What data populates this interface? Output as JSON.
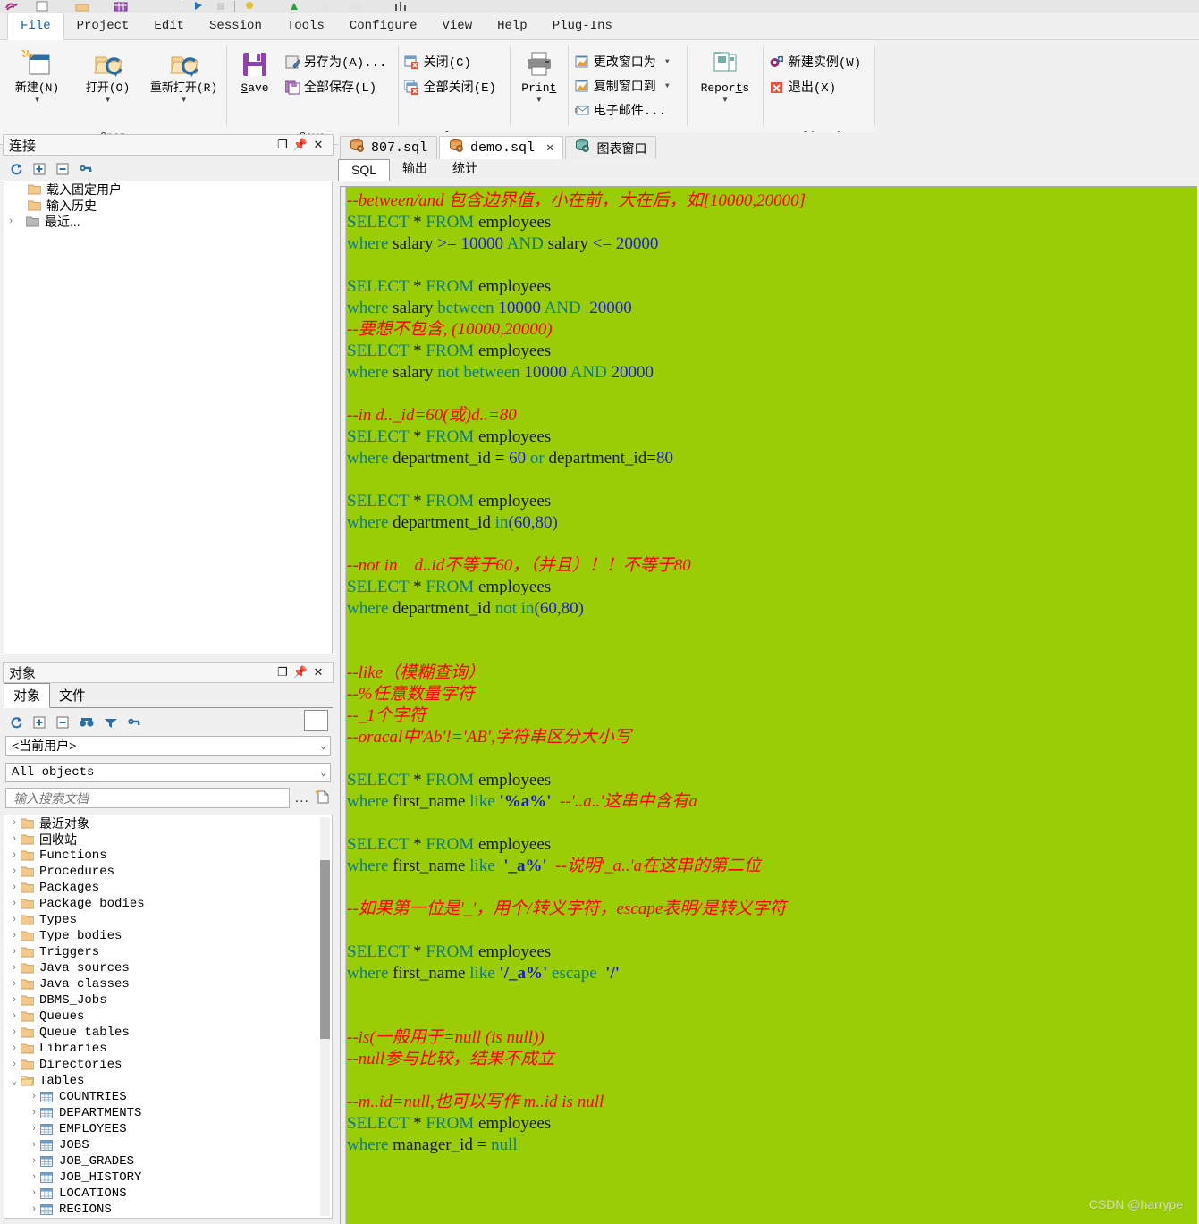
{
  "menu": {
    "tabs": [
      {
        "label": "File",
        "active": true
      },
      {
        "label": "Project",
        "active": false
      },
      {
        "label": "Edit",
        "active": false
      },
      {
        "label": "Session",
        "active": false
      },
      {
        "label": "Tools",
        "active": false
      },
      {
        "label": "Configure",
        "active": false
      },
      {
        "label": "View",
        "active": false
      },
      {
        "label": "Help",
        "active": false
      },
      {
        "label": "Plug-Ins",
        "active": false
      }
    ]
  },
  "ribbon": {
    "groups": [
      {
        "caption": "Open",
        "big_buttons": [
          {
            "label": "新建(N)",
            "icon": "new-document-icon",
            "caret": true
          },
          {
            "label": "打开(O)",
            "icon": "open-folder-icon",
            "caret": true
          },
          {
            "label": "重新打开(R)",
            "icon": "reopen-folder-icon",
            "caret": true
          }
        ]
      },
      {
        "caption": "Save",
        "big_buttons": [
          {
            "label": "Save",
            "icon": "floppy-disk-icon",
            "caret": false
          }
        ],
        "small_buttons": [
          {
            "label": "另存为(A)...",
            "icon": "save-as-icon",
            "caret": false
          },
          {
            "label": "全部保存(L)",
            "icon": "save-all-icon",
            "caret": false
          }
        ]
      },
      {
        "caption": "Close",
        "small_buttons": [
          {
            "label": "关闭(C)",
            "icon": "close-window-icon",
            "caret": false
          },
          {
            "label": "全部关闭(E)",
            "icon": "close-all-windows-icon",
            "caret": false
          }
        ]
      },
      {
        "caption": "",
        "big_buttons": [
          {
            "label": "Print",
            "icon": "printer-icon",
            "caret": true
          }
        ]
      },
      {
        "caption": "Document",
        "small_buttons": [
          {
            "label": "更改窗口为",
            "icon": "change-window-icon",
            "caret": true
          },
          {
            "label": "复制窗口到",
            "icon": "copy-window-icon",
            "caret": true
          },
          {
            "label": "电子邮件...",
            "icon": "email-icon",
            "caret": false
          }
        ]
      },
      {
        "caption": "",
        "big_buttons": [
          {
            "label": "Reports",
            "icon": "reports-icon",
            "caret": true
          }
        ]
      },
      {
        "caption": "Application",
        "small_buttons": [
          {
            "label": "新建实例(W)",
            "icon": "new-instance-icon",
            "caret": false
          },
          {
            "label": "退出(X)",
            "icon": "exit-icon",
            "caret": false
          }
        ]
      }
    ]
  },
  "connections_pane": {
    "title": "连接",
    "window_buttons": [
      "maximize-icon",
      "pin-icon",
      "close-icon"
    ],
    "toolbar_icons": [
      "refresh-icon",
      "expand-all-icon",
      "collapse-all-icon",
      "add-connection-icon"
    ],
    "tree": [
      {
        "label": "载入固定用户",
        "icon": "folder-icon",
        "expander": "",
        "indent": 1
      },
      {
        "label": "输入历史",
        "icon": "folder-icon",
        "expander": "",
        "indent": 1
      },
      {
        "label": "最近...",
        "icon": "folder-gray-icon",
        "expander": "›",
        "indent": 0
      }
    ]
  },
  "objects_pane": {
    "title": "对象",
    "window_buttons": [
      "maximize-icon",
      "pin-icon",
      "close-icon"
    ],
    "tabs": [
      {
        "label": "对象",
        "active": true
      },
      {
        "label": "文件",
        "active": false
      }
    ],
    "toolbar_icons": [
      "refresh-icon",
      "expand-all-icon",
      "collapse-all-icon",
      "find-icon",
      "filter-icon",
      "key-icon"
    ],
    "user_select": "<当前用户>",
    "filter_select": "All objects",
    "search_placeholder": "输入搜索文档",
    "search_value": "",
    "more_button": "...",
    "new_doc_icon": "new-document-icon",
    "tree": [
      {
        "label": "最近对象",
        "icon": "folder-icon",
        "indent": 0,
        "expander": "›"
      },
      {
        "label": "回收站",
        "icon": "folder-icon",
        "indent": 0,
        "expander": "›"
      },
      {
        "label": "Functions",
        "icon": "folder-icon",
        "indent": 0,
        "expander": "›"
      },
      {
        "label": "Procedures",
        "icon": "folder-icon",
        "indent": 0,
        "expander": "›"
      },
      {
        "label": "Packages",
        "icon": "folder-icon",
        "indent": 0,
        "expander": "›"
      },
      {
        "label": "Package bodies",
        "icon": "folder-icon",
        "indent": 0,
        "expander": "›"
      },
      {
        "label": "Types",
        "icon": "folder-icon",
        "indent": 0,
        "expander": "›"
      },
      {
        "label": "Type bodies",
        "icon": "folder-icon",
        "indent": 0,
        "expander": "›"
      },
      {
        "label": "Triggers",
        "icon": "folder-icon",
        "indent": 0,
        "expander": "›"
      },
      {
        "label": "Java sources",
        "icon": "folder-icon",
        "indent": 0,
        "expander": "›"
      },
      {
        "label": "Java classes",
        "icon": "folder-icon",
        "indent": 0,
        "expander": "›"
      },
      {
        "label": "DBMS_Jobs",
        "icon": "folder-icon",
        "indent": 0,
        "expander": "›"
      },
      {
        "label": "Queues",
        "icon": "folder-icon",
        "indent": 0,
        "expander": "›"
      },
      {
        "label": "Queue tables",
        "icon": "folder-icon",
        "indent": 0,
        "expander": "›"
      },
      {
        "label": "Libraries",
        "icon": "folder-icon",
        "indent": 0,
        "expander": "›"
      },
      {
        "label": "Directories",
        "icon": "folder-icon",
        "indent": 0,
        "expander": "›"
      },
      {
        "label": "Tables",
        "icon": "folder-open-icon",
        "indent": 0,
        "expander": "v"
      },
      {
        "label": "COUNTRIES",
        "icon": "table-icon",
        "indent": 1,
        "expander": "›"
      },
      {
        "label": "DEPARTMENTS",
        "icon": "table-icon",
        "indent": 1,
        "expander": "›"
      },
      {
        "label": "EMPLOYEES",
        "icon": "table-icon",
        "indent": 1,
        "expander": "›"
      },
      {
        "label": "JOBS",
        "icon": "table-icon",
        "indent": 1,
        "expander": "›"
      },
      {
        "label": "JOB_GRADES",
        "icon": "table-icon",
        "indent": 1,
        "expander": "›"
      },
      {
        "label": "JOB_HISTORY",
        "icon": "table-icon",
        "indent": 1,
        "expander": "›"
      },
      {
        "label": "LOCATIONS",
        "icon": "table-icon",
        "indent": 1,
        "expander": "›"
      },
      {
        "label": "REGIONS",
        "icon": "table-icon",
        "indent": 1,
        "expander": "›"
      }
    ]
  },
  "document_tabs": [
    {
      "label": "807.sql",
      "icon": "database-icon",
      "active": false,
      "closable": false
    },
    {
      "label": "demo.sql",
      "icon": "database-icon",
      "active": true,
      "closable": true,
      "close_label": "✕"
    },
    {
      "label": "图表窗口",
      "icon": "database-teal-icon",
      "active": false,
      "closable": false
    }
  ],
  "editor_subtabs": [
    {
      "label": "SQL",
      "active": true
    },
    {
      "label": "输出",
      "active": false
    },
    {
      "label": "统计",
      "active": false
    }
  ],
  "editor": {
    "background_color": "#9acd05",
    "comment_color": "#ff0000",
    "keyword_color": "#0b7b84",
    "number_color": "#1a1aee",
    "string_color": "#1616e0",
    "lines": [
      [
        {
          "t": "--between/and 包含边界值，小在前，大在后，如[10000,20000]",
          "c": "cmt"
        }
      ],
      [
        {
          "t": "SELECT",
          "c": "kw"
        },
        {
          "t": " * ",
          "c": "id"
        },
        {
          "t": "FROM",
          "c": "kw"
        },
        {
          "t": " employees",
          "c": "id"
        }
      ],
      [
        {
          "t": "where",
          "c": "kw"
        },
        {
          "t": " salary ",
          "c": "id"
        },
        {
          "t": ">=",
          "c": "op"
        },
        {
          "t": " ",
          "c": "id"
        },
        {
          "t": "10000",
          "c": "num"
        },
        {
          "t": " ",
          "c": "id"
        },
        {
          "t": "AND",
          "c": "kw"
        },
        {
          "t": " salary ",
          "c": "id"
        },
        {
          "t": "<=",
          "c": "op"
        },
        {
          "t": " ",
          "c": "id"
        },
        {
          "t": "20000",
          "c": "num"
        }
      ],
      [],
      [
        {
          "t": "SELECT",
          "c": "kw"
        },
        {
          "t": " * ",
          "c": "id"
        },
        {
          "t": "FROM",
          "c": "kw"
        },
        {
          "t": " employees",
          "c": "id"
        }
      ],
      [
        {
          "t": "where",
          "c": "kw"
        },
        {
          "t": " salary ",
          "c": "id"
        },
        {
          "t": "between",
          "c": "kw"
        },
        {
          "t": " ",
          "c": "id"
        },
        {
          "t": "10000",
          "c": "num"
        },
        {
          "t": " ",
          "c": "id"
        },
        {
          "t": "AND",
          "c": "kw"
        },
        {
          "t": "  ",
          "c": "id"
        },
        {
          "t": "20000",
          "c": "num"
        }
      ],
      [
        {
          "t": "--要想不包含, (10000,20000)",
          "c": "cmt"
        }
      ],
      [
        {
          "t": "SELECT",
          "c": "kw"
        },
        {
          "t": " * ",
          "c": "id"
        },
        {
          "t": "FROM",
          "c": "kw"
        },
        {
          "t": " employees",
          "c": "id"
        }
      ],
      [
        {
          "t": "where",
          "c": "kw"
        },
        {
          "t": " salary ",
          "c": "id"
        },
        {
          "t": "not",
          "c": "kw"
        },
        {
          "t": " ",
          "c": "id"
        },
        {
          "t": "between",
          "c": "kw"
        },
        {
          "t": " ",
          "c": "id"
        },
        {
          "t": "10000",
          "c": "num"
        },
        {
          "t": " ",
          "c": "id"
        },
        {
          "t": "AND",
          "c": "kw"
        },
        {
          "t": " ",
          "c": "id"
        },
        {
          "t": "20000",
          "c": "num"
        }
      ],
      [],
      [
        {
          "t": "--in d.._id=60(或)d..=80",
          "c": "cmt"
        }
      ],
      [
        {
          "t": "SELECT",
          "c": "kw"
        },
        {
          "t": " * ",
          "c": "id"
        },
        {
          "t": "FROM",
          "c": "kw"
        },
        {
          "t": " employees",
          "c": "id"
        }
      ],
      [
        {
          "t": "where",
          "c": "kw"
        },
        {
          "t": " department_id = ",
          "c": "id"
        },
        {
          "t": "60",
          "c": "num"
        },
        {
          "t": " ",
          "c": "id"
        },
        {
          "t": "or",
          "c": "kw"
        },
        {
          "t": " department_id=",
          "c": "id"
        },
        {
          "t": "80",
          "c": "num"
        }
      ],
      [],
      [
        {
          "t": "SELECT",
          "c": "kw"
        },
        {
          "t": " * ",
          "c": "id"
        },
        {
          "t": "FROM",
          "c": "kw"
        },
        {
          "t": " employees",
          "c": "id"
        }
      ],
      [
        {
          "t": "where",
          "c": "kw"
        },
        {
          "t": " department_id ",
          "c": "id"
        },
        {
          "t": "in",
          "c": "kw"
        },
        {
          "t": "(",
          "c": "op"
        },
        {
          "t": "60",
          "c": "num"
        },
        {
          "t": ",",
          "c": "op"
        },
        {
          "t": "80",
          "c": "num"
        },
        {
          "t": ")",
          "c": "op"
        }
      ],
      [],
      [
        {
          "t": "--not in    d..id不等于60，（并且）！！不等于80",
          "c": "cmt"
        }
      ],
      [
        {
          "t": "SELECT",
          "c": "kw"
        },
        {
          "t": " * ",
          "c": "id"
        },
        {
          "t": "FROM",
          "c": "kw"
        },
        {
          "t": " employees",
          "c": "id"
        }
      ],
      [
        {
          "t": "where",
          "c": "kw"
        },
        {
          "t": " department_id ",
          "c": "id"
        },
        {
          "t": "not",
          "c": "kw"
        },
        {
          "t": " ",
          "c": "id"
        },
        {
          "t": "in",
          "c": "kw"
        },
        {
          "t": "(",
          "c": "op"
        },
        {
          "t": "60",
          "c": "num"
        },
        {
          "t": ",",
          "c": "op"
        },
        {
          "t": "80",
          "c": "num"
        },
        {
          "t": ")",
          "c": "op"
        }
      ],
      [],
      [],
      [
        {
          "t": "--like（模糊查询）",
          "c": "cmt"
        }
      ],
      [
        {
          "t": "--%任意数量字符",
          "c": "cmt"
        }
      ],
      [
        {
          "t": "--_1个字符",
          "c": "cmt"
        }
      ],
      [
        {
          "t": "--oracal中'Ab'!='AB',字符串区分大小写",
          "c": "cmt"
        }
      ],
      [],
      [
        {
          "t": "SELECT",
          "c": "kw"
        },
        {
          "t": " * ",
          "c": "id"
        },
        {
          "t": "FROM",
          "c": "kw"
        },
        {
          "t": " employees",
          "c": "id"
        }
      ],
      [
        {
          "t": "where",
          "c": "kw"
        },
        {
          "t": " first_name ",
          "c": "id"
        },
        {
          "t": "like",
          "c": "kw"
        },
        {
          "t": " ",
          "c": "id"
        },
        {
          "t": "'%a%'",
          "c": "str"
        },
        {
          "t": "  ",
          "c": "id"
        },
        {
          "t": "--'..a..'这串中含有a",
          "c": "cmt"
        }
      ],
      [],
      [
        {
          "t": "SELECT",
          "c": "kw"
        },
        {
          "t": " * ",
          "c": "id"
        },
        {
          "t": "FROM",
          "c": "kw"
        },
        {
          "t": " employees",
          "c": "id"
        }
      ],
      [
        {
          "t": "where",
          "c": "kw"
        },
        {
          "t": " first_name ",
          "c": "id"
        },
        {
          "t": "like",
          "c": "kw"
        },
        {
          "t": "  ",
          "c": "id"
        },
        {
          "t": "'_a%'",
          "c": "str"
        },
        {
          "t": "  ",
          "c": "id"
        },
        {
          "t": "--说明'_a..'a在这串的第二位",
          "c": "cmt"
        }
      ],
      [],
      [
        {
          "t": "--如果第一位是'_'，用个/转义字符，escape表明/是转义字符",
          "c": "cmt"
        }
      ],
      [],
      [
        {
          "t": "SELECT",
          "c": "kw"
        },
        {
          "t": " * ",
          "c": "id"
        },
        {
          "t": "FROM",
          "c": "kw"
        },
        {
          "t": " employees",
          "c": "id"
        }
      ],
      [
        {
          "t": "where",
          "c": "kw"
        },
        {
          "t": " first_name ",
          "c": "id"
        },
        {
          "t": "like",
          "c": "kw"
        },
        {
          "t": " ",
          "c": "id"
        },
        {
          "t": "'/_a%'",
          "c": "str"
        },
        {
          "t": " ",
          "c": "id"
        },
        {
          "t": "escape",
          "c": "kw"
        },
        {
          "t": "  ",
          "c": "id"
        },
        {
          "t": "'/'",
          "c": "str"
        }
      ],
      [],
      [],
      [
        {
          "t": "--is(一般用于=null (is null))",
          "c": "cmt"
        }
      ],
      [
        {
          "t": "--null参与比较，结果不成立",
          "c": "cmt"
        }
      ],
      [],
      [
        {
          "t": "--m..id=null,也可以写作 m..id is null",
          "c": "cmt"
        }
      ],
      [
        {
          "t": "SELECT",
          "c": "kw"
        },
        {
          "t": " * ",
          "c": "id"
        },
        {
          "t": "FROM",
          "c": "kw"
        },
        {
          "t": " employees",
          "c": "id"
        }
      ],
      [
        {
          "t": "where",
          "c": "kw"
        },
        {
          "t": " manager_id = ",
          "c": "id"
        },
        {
          "t": "null",
          "c": "kw"
        }
      ]
    ]
  },
  "watermark": "CSDN @harrype"
}
